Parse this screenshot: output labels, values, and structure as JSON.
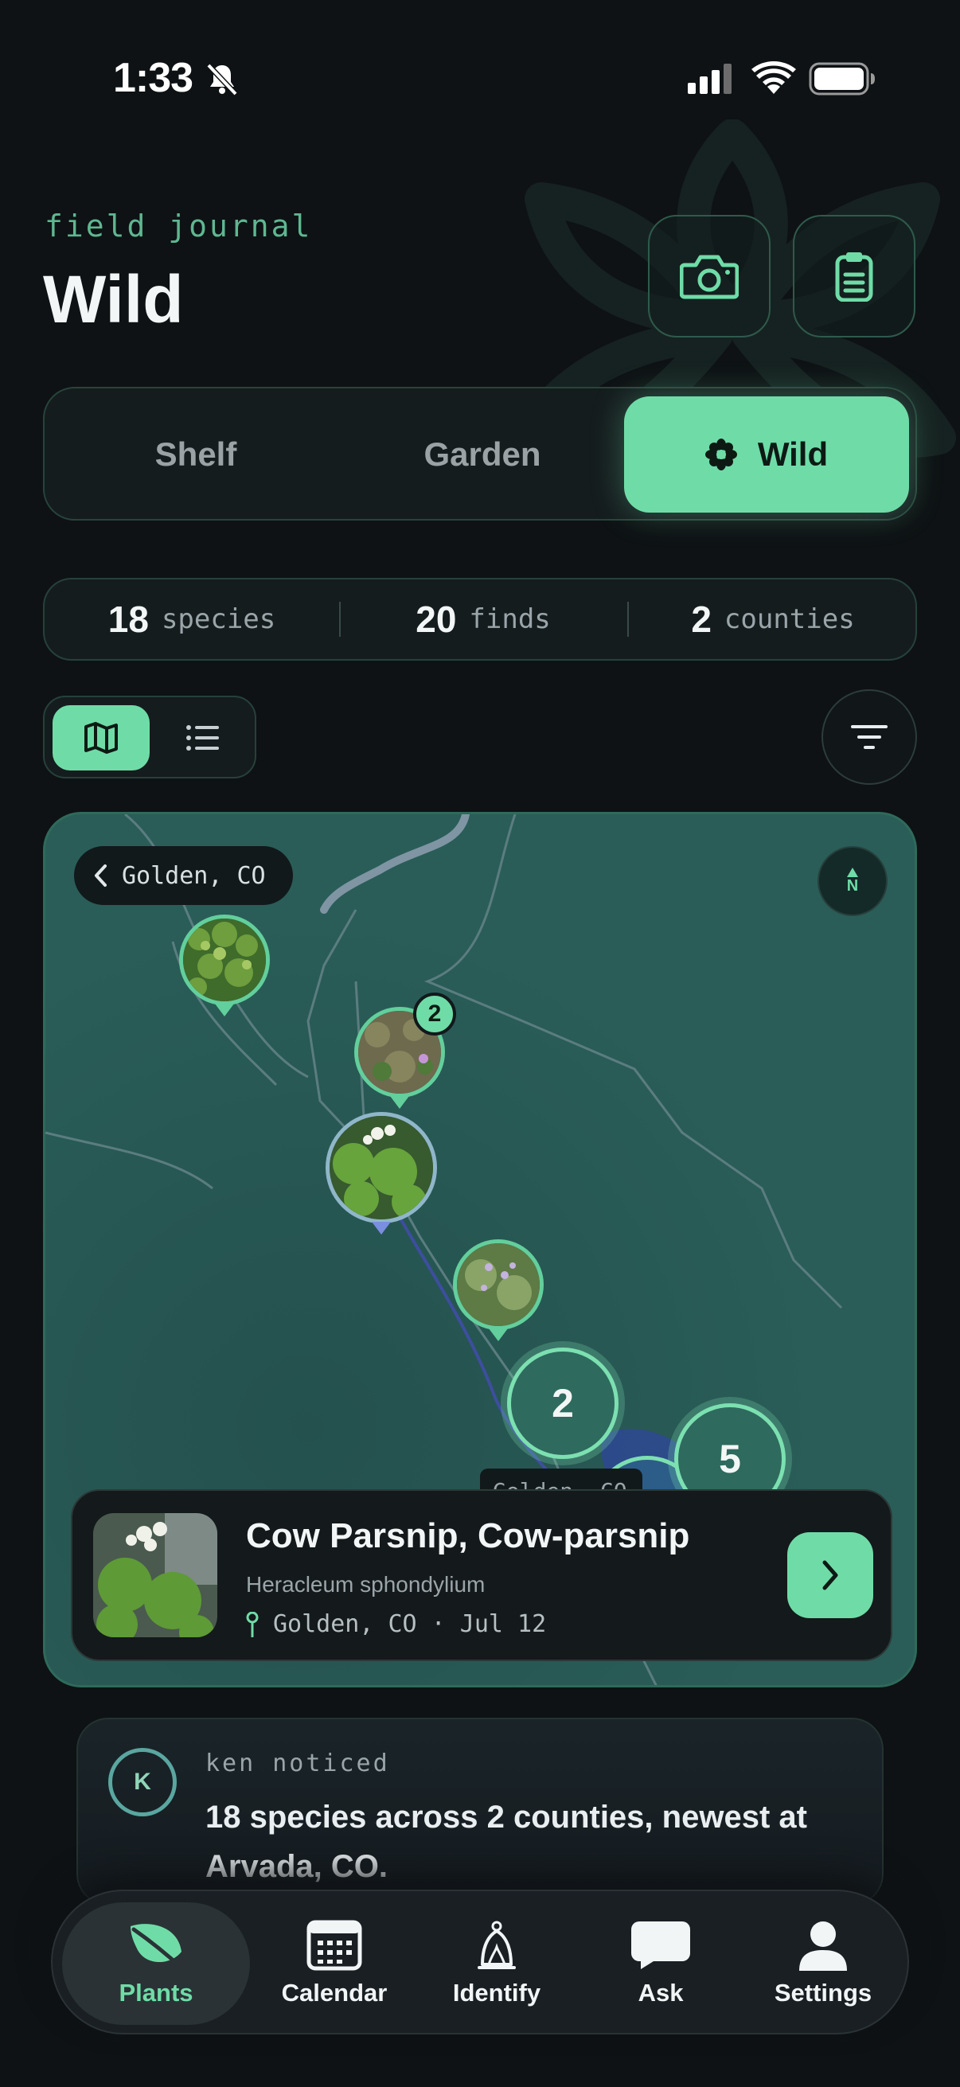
{
  "status_bar": {
    "time": "1:33"
  },
  "header": {
    "eyebrow": "field journal",
    "title": "Wild"
  },
  "segments": {
    "shelf": "Shelf",
    "garden": "Garden",
    "wild": "Wild",
    "selected": "Wild"
  },
  "stats": [
    {
      "value": "18",
      "label": "species"
    },
    {
      "value": "20",
      "label": "finds"
    },
    {
      "value": "2",
      "label": "counties"
    }
  ],
  "view_toggle": {
    "selected": "map"
  },
  "map": {
    "location_chip": "Golden, CO",
    "compass_label": "N",
    "cluster_badge": "2",
    "cluster_a": "2",
    "cluster_b": "5",
    "partial_label": "Golden, CO"
  },
  "species_card": {
    "common_name": "Cow Parsnip, Cow-parsnip",
    "scientific_name": "Heracleum sphondylium",
    "meta": "Golden, CO · Jul 12"
  },
  "insight": {
    "avatar_initial": "K",
    "kicker": "ken noticed",
    "text": "18 species across 2 counties, newest at Arvada, CO."
  },
  "tabbar": {
    "items": [
      "Plants",
      "Calendar",
      "Identify",
      "Ask",
      "Settings"
    ],
    "active": "Plants"
  },
  "colors": {
    "accent": "#6fdca7",
    "background": "#0e1214",
    "map": "#2a5c58"
  },
  "icons": [
    "bell-slash-icon",
    "signal-icon",
    "wifi-icon",
    "battery-icon",
    "camera-icon",
    "clipboard-icon",
    "flower-icon",
    "map-icon",
    "list-icon",
    "filter-icon",
    "chevron-left-icon",
    "compass-icon",
    "pin-icon",
    "chevron-right-icon",
    "leaf-icon",
    "calendar-icon",
    "identify-icon",
    "chat-icon",
    "person-icon"
  ]
}
